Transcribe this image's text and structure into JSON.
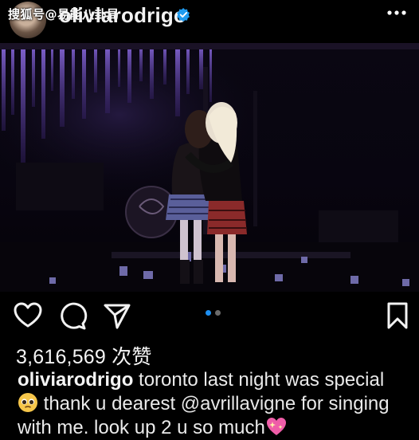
{
  "watermark": "搜狐号@易能八卦局",
  "post": {
    "username": "oliviarodrigo",
    "likes": "3,616,569 次赞",
    "caption": {
      "user": "oliviarodrigo",
      "line1": " toronto last night was special",
      "line2a": " thank u dearest ",
      "mention": "@avrillavigne",
      "line2b": " for singing",
      "line3": "with me. look up 2 u so much"
    },
    "carousel": {
      "count": 2,
      "active": 0
    }
  },
  "icons": [
    "verified-badge-icon",
    "more-options-icon",
    "heart-icon",
    "comment-icon",
    "share-icon",
    "bookmark-icon",
    "pleading-face-emoji-icon",
    "sparkling-heart-emoji-icon"
  ],
  "colors": {
    "background": "#000000",
    "verified": "#1f9bf0",
    "active_dot": "#1d8ff2",
    "inactive_dot": "#6b6b6b",
    "stage_lights": "#7a5ad0"
  }
}
